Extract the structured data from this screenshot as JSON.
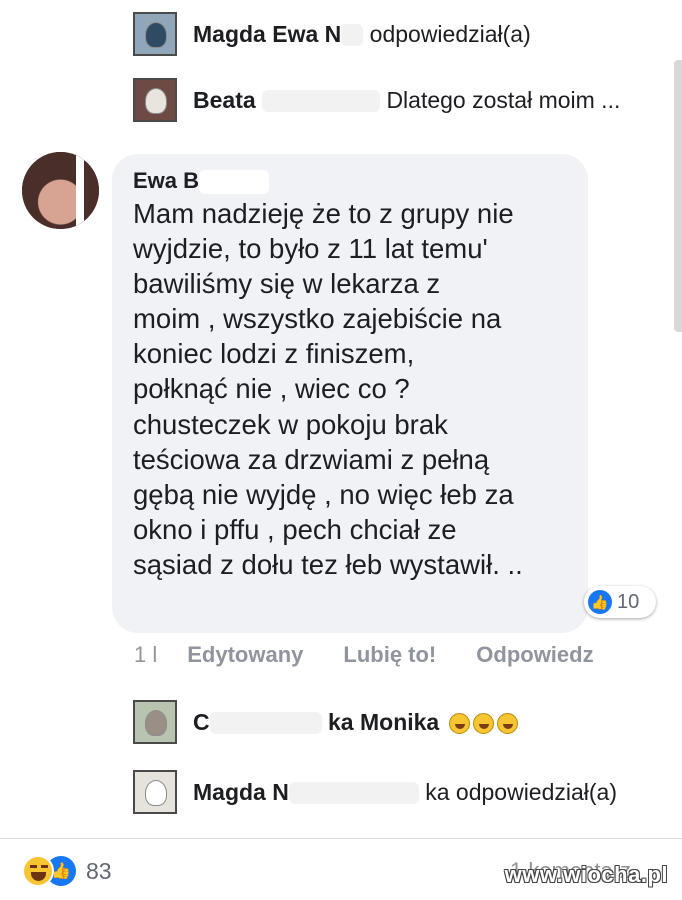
{
  "replies_top": [
    {
      "name": "Magda Ewa N",
      "text": "odpowiedział(a)"
    },
    {
      "name": "Beata ",
      "text": "Dlatego został moim ..."
    }
  ],
  "comment": {
    "author": "Ewa B",
    "lines": [
      "Mam nadzieję że to z grupy nie",
      "wyjdzie, to było z 11 lat temu'",
      "bawiliśmy się w lekarza z",
      "moim , wszystko zajebiście na",
      "koniec lodzi z finiszem,",
      "połknąć nie , wiec co ?",
      "chusteczek w pokoju brak",
      "teściowa za drzwiami z pełną",
      "gębą nie wyjdę , no więc łeb  za",
      "okno i pffu , pech chciał ze",
      "sąsiad z dołu tez łeb wystawił. .."
    ],
    "reaction_count": "10",
    "time": "1 l",
    "edited_label": "Edytowany",
    "like_label": "Lubię to!",
    "reply_label": "Odpowiedz"
  },
  "replies_bottom": [
    {
      "name": "C",
      "text": "ka Monika"
    },
    {
      "name": "Magda N",
      "text": "ka odpowiedział(a)"
    }
  ],
  "footer": {
    "reaction_total": "83",
    "comments_partial": "1 komentarz",
    "watermark": "www.wiocha.pl"
  },
  "colors": {
    "accent": "#1877f2",
    "bubble": "#f0f2f5",
    "muted": "#90949c"
  },
  "icons": {
    "like": "like-icon",
    "haha": "haha-emoji-icon",
    "laugh_emoji": "grinning-face-icon"
  }
}
